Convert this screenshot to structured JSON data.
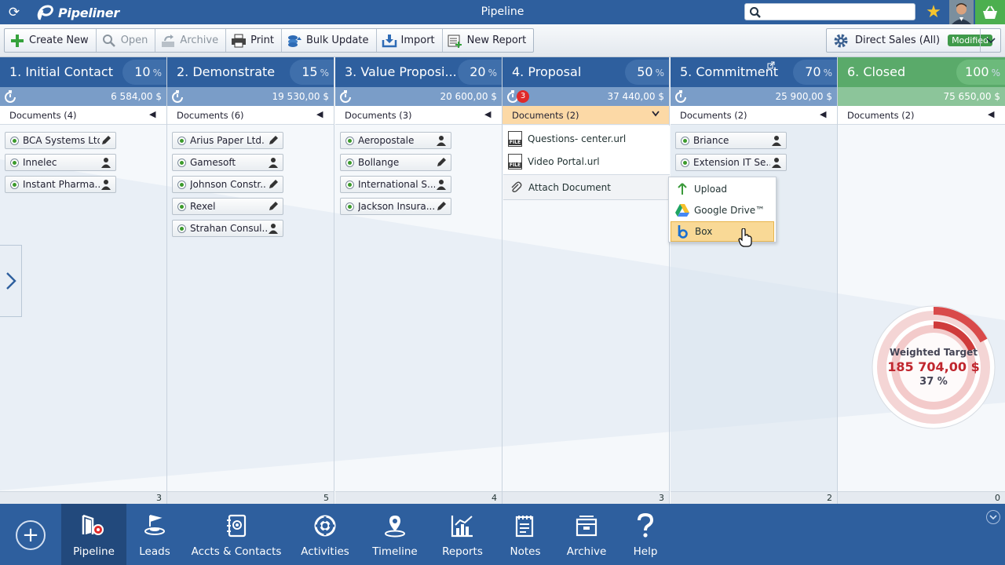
{
  "app": {
    "name": "Pipeliner",
    "window_title": "Pipeline"
  },
  "search": {
    "placeholder": ""
  },
  "toolbar": {
    "buttons": [
      {
        "label": "Create New",
        "icon": "plus-icon"
      },
      {
        "label": "Open",
        "icon": "magnifier-icon"
      },
      {
        "label": "Archive",
        "icon": "archive-icon"
      },
      {
        "label": "Print",
        "icon": "printer-icon"
      },
      {
        "label": "Bulk Update",
        "icon": "bulk-update-icon"
      },
      {
        "label": "Import",
        "icon": "import-icon"
      },
      {
        "label": "New Report",
        "icon": "new-report-icon"
      }
    ],
    "view": {
      "label": "Direct Sales (All)",
      "badge": "Modified"
    }
  },
  "stages": [
    {
      "name": "1. Initial Contact",
      "percent": "10",
      "pct_unit": "%",
      "sum": "6 584,00 $",
      "docs": "Documents (4)",
      "count": "3",
      "cards": [
        {
          "name": "BCA Systems Ltd.",
          "icon": "pencil-icon"
        },
        {
          "name": "Innelec",
          "icon": "person-icon"
        },
        {
          "name": "Instant Pharma...",
          "icon": "person-icon"
        }
      ]
    },
    {
      "name": "2. Demonstrate",
      "percent": "15",
      "pct_unit": "%",
      "sum": "19 530,00 $",
      "docs": "Documents (6)",
      "count": "5",
      "cards": [
        {
          "name": "Arius Paper Ltd.",
          "icon": "pencil-icon"
        },
        {
          "name": "Gamesoft",
          "icon": "person-icon"
        },
        {
          "name": "Johnson Constr...",
          "icon": "pencil-icon"
        },
        {
          "name": "Rexel",
          "icon": "pencil-icon"
        },
        {
          "name": "Strahan Consul...",
          "icon": "person-icon"
        }
      ]
    },
    {
      "name": "3. Value Proposi...",
      "percent": "20",
      "pct_unit": "%",
      "sum": "20 600,00 $",
      "docs": "Documents (3)",
      "count": "4",
      "cards": [
        {
          "name": "Aeropostale",
          "icon": "person-icon"
        },
        {
          "name": "Bollange",
          "icon": "pencil-icon"
        },
        {
          "name": "International S...",
          "icon": "person-icon"
        },
        {
          "name": "Jackson Insura...",
          "icon": "pencil-icon"
        }
      ]
    },
    {
      "name": "4. Proposal",
      "percent": "50",
      "pct_unit": "%",
      "sum": "37 440,00 $",
      "docs": "Documents (2)",
      "count": "3",
      "alert": "3",
      "cards": []
    },
    {
      "name": "5. Commitment",
      "percent": "70",
      "pct_unit": "%",
      "sum": "25 900,00 $",
      "docs": "Documents (2)",
      "count": "2",
      "cards": [
        {
          "name": "Briance",
          "icon": "person-icon"
        },
        {
          "name": "Extension IT Se...",
          "icon": "person-icon"
        }
      ]
    },
    {
      "name": "6. Closed",
      "percent": "100",
      "pct_unit": "%",
      "sum": "75 650,00 $",
      "docs": "Documents (2)",
      "count": "0",
      "cards": []
    }
  ],
  "proposal_docs": {
    "files": [
      {
        "name": "Questions- center.url",
        "tag": "FILE"
      },
      {
        "name": "Video Portal.url",
        "tag": "FILE"
      }
    ],
    "attach_label": "Attach Document"
  },
  "attach_menu": [
    {
      "label": "Upload",
      "icon": "upload-arrow-icon"
    },
    {
      "label": "Google Drive™",
      "icon": "google-drive-icon"
    },
    {
      "label": "Box",
      "icon": "box-icon"
    }
  ],
  "weighted_target": {
    "label": "Weighted Target",
    "amount": "185 704,00 $",
    "percent": "37 %"
  },
  "bottom_nav": [
    {
      "label": "Pipeline",
      "icon": "pipeline-icon",
      "active": true
    },
    {
      "label": "Leads",
      "icon": "leads-icon"
    },
    {
      "label": "Accts & Contacts",
      "icon": "contacts-icon"
    },
    {
      "label": "Activities",
      "icon": "activities-icon"
    },
    {
      "label": "Timeline",
      "icon": "timeline-icon"
    },
    {
      "label": "Reports",
      "icon": "reports-icon"
    },
    {
      "label": "Notes",
      "icon": "notes-icon"
    },
    {
      "label": "Archive",
      "icon": "archive-box-icon"
    },
    {
      "label": "Help",
      "icon": "help-icon"
    }
  ],
  "colors": {
    "header_blue": "#2e5f9e",
    "sum_blue": "#7a9dc8",
    "closed_green": "#5aaa6a",
    "proposal_highlight": "#fcd9a6",
    "target_red": "#c0262e"
  }
}
